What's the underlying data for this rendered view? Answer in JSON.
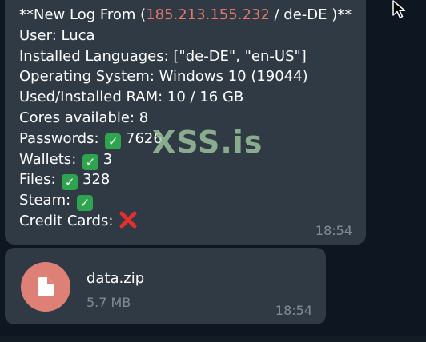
{
  "messages": {
    "log": {
      "header_prefix": "**New Log From (",
      "ip": "185.213.155.232",
      "header_suffix": " / de-DE )**",
      "user": "User: Luca",
      "languages": "Installed Languages: [\"de-DE\", \"en-US\"]",
      "os": "Operating System: Windows 10 (19044)",
      "ram": "Used/Installed RAM: 10 / 16 GB",
      "cores": "Cores available: 8",
      "passwords_label": "Passwords:",
      "passwords_value": "7626",
      "wallets_label": "Wallets:",
      "wallets_value": "3",
      "files_label": "Files:",
      "files_value": "328",
      "steam_label": "Steam:",
      "credit_cards_label": "Credit Cards:",
      "check_mark": "✓",
      "time": "18:54"
    },
    "file": {
      "name": "data.zip",
      "size": "5.7 MB",
      "time": "18:54"
    }
  },
  "watermark": "XSS.is",
  "icons": [
    "check-mark-icon",
    "cross-mark-icon",
    "file-icon",
    "cursor-icon"
  ],
  "colors": {
    "background": "#0e1621",
    "bubble": "#303a45",
    "ip_text": "#e5756b",
    "timestamp": "#7f8b97",
    "file_icon": "#df8077",
    "check": "#2ea44f",
    "cross": "#e03030"
  }
}
